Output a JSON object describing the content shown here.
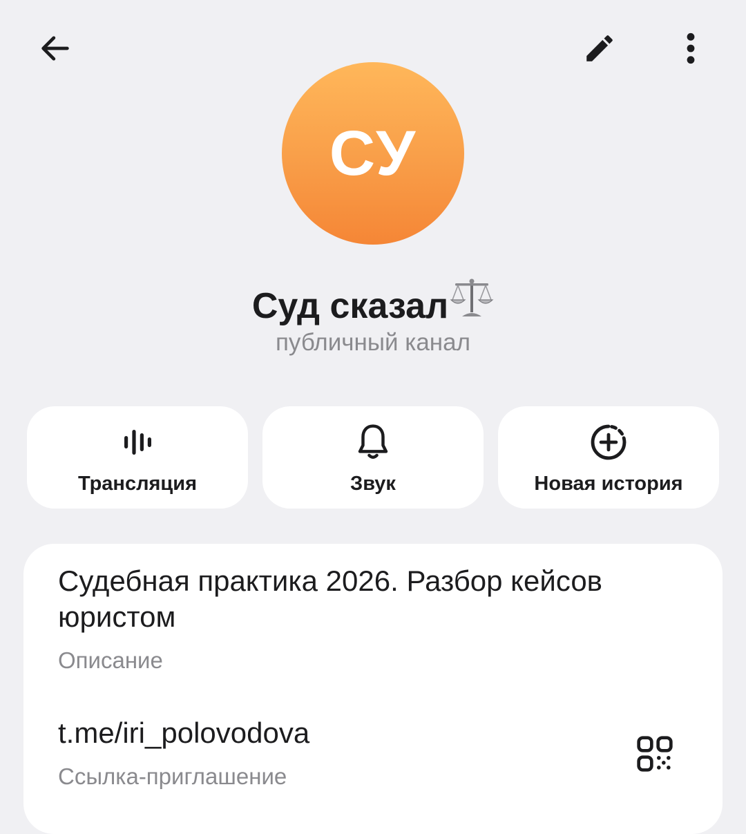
{
  "header": {
    "back_icon": "arrow-left-icon",
    "edit_icon": "pencil-icon",
    "more_icon": "more-vertical-icon"
  },
  "profile": {
    "avatar_initials": "СУ",
    "avatar_colors": [
      "#ffb75a",
      "#f58636"
    ],
    "name": "Суд сказал",
    "name_emoji": "balance-scale-icon",
    "subtitle": "публичный канал"
  },
  "actions": [
    {
      "label": "Трансляция",
      "icon": "live-stream-icon"
    },
    {
      "label": "Звук",
      "icon": "bell-icon"
    },
    {
      "label": "Новая история",
      "icon": "add-story-icon"
    }
  ],
  "info": {
    "description": "Судебная практика 2026. Разбор кейсов юристом",
    "description_label": "Описание",
    "link": "t.me/iri_polovodova",
    "link_label": "Ссылка-приглашение",
    "qr_icon": "qr-code-icon"
  }
}
